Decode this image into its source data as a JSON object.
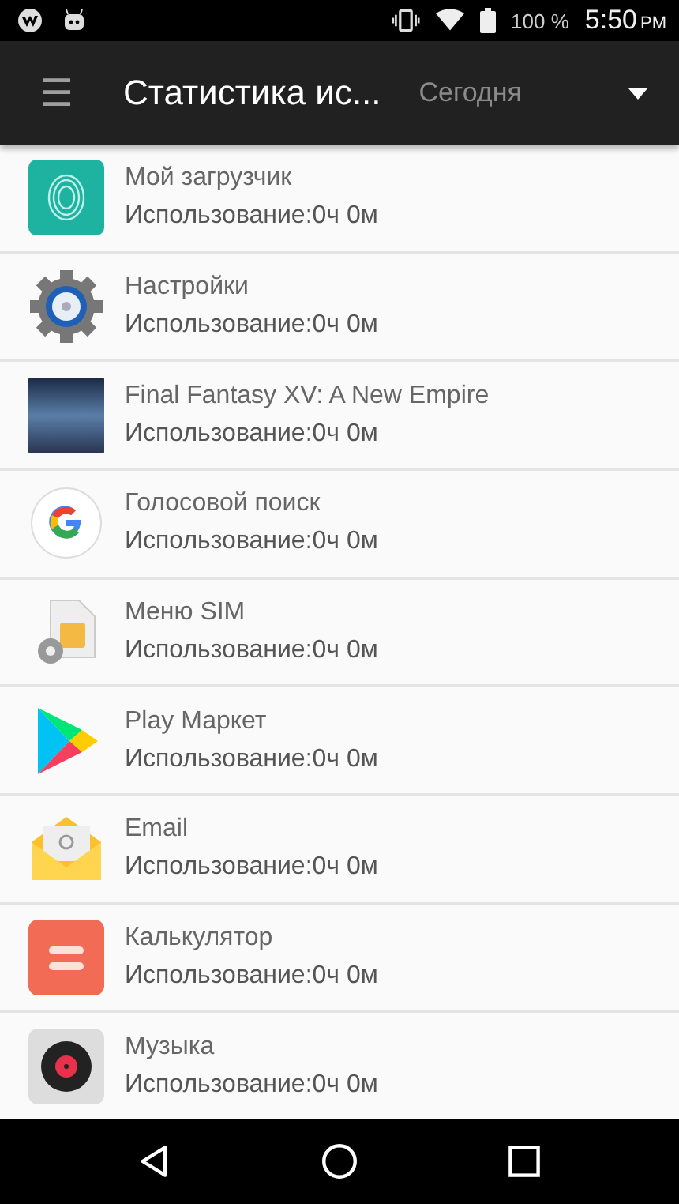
{
  "status_bar": {
    "battery": "100 %",
    "time": "5:50",
    "ampm": "PM"
  },
  "toolbar": {
    "menu_icon": "☰",
    "title": "Статистика ис...",
    "spinner": "Сегодня"
  },
  "apps": [
    {
      "kind": "downloader",
      "name": "Мой загрузчик",
      "usage": "Использование:0ч 0м"
    },
    {
      "kind": "settings",
      "name": "Настройки",
      "usage": "Использование:0ч 0м"
    },
    {
      "kind": "game",
      "name": "Final Fantasy XV: A New Empire",
      "usage": "Использование:0ч 0м"
    },
    {
      "kind": "google",
      "name": "Голосовой поиск",
      "usage": "Использование:0ч 0м"
    },
    {
      "kind": "sim",
      "name": "Меню SIM",
      "usage": "Использование:0ч 0м"
    },
    {
      "kind": "play",
      "name": "Play Маркет",
      "usage": "Использование:0ч 0м"
    },
    {
      "kind": "email",
      "name": "Email",
      "usage": "Использование:0ч 0м"
    },
    {
      "kind": "calculator",
      "name": "Калькулятор",
      "usage": "Использование:0ч 0м"
    },
    {
      "kind": "music",
      "name": "Музыка",
      "usage": "Использование:0ч 0м"
    }
  ]
}
